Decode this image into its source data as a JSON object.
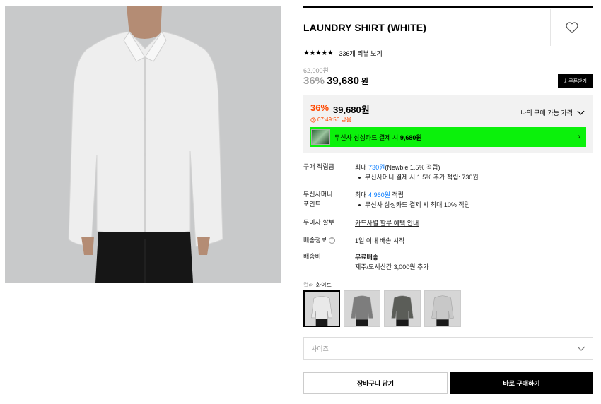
{
  "product": {
    "title": "LAUNDRY SHIRT (WHITE)",
    "rating_stars": "★★★★★",
    "review_link": "336개 리뷰 보기",
    "original_price": "62,000원",
    "discount_pct": "36%",
    "sale_price": "39,680",
    "sale_won": "원",
    "coupon_label": "쿠폰받기"
  },
  "benefit_box": {
    "discount_pct": "36%",
    "price": "39,680원",
    "timer": "07:49:56 남음",
    "my_price_label": "나의 구매 가능 가격",
    "card_banner_prefix": "무신사 삼성카드 결제 시 ",
    "card_banner_price": "9,680원"
  },
  "info": {
    "points_label": "구매 적립금",
    "points_prefix": "최대 ",
    "points_amount": "730원",
    "points_suffix": "(Newbie 1.5% 적립)",
    "points_bullet": "무신사머니 결제 시 1.5% 추가 적립: 730원",
    "money_label_1": "무신사머니",
    "money_label_2": "포인트",
    "money_prefix": "최대 ",
    "money_amount": "4,960원",
    "money_suffix": " 적립",
    "money_bullet": "무신사 삼성카드 결제 시 최대 10% 적립",
    "installment_label": "무이자 할부",
    "installment_link": "카드사별 할부 혜택 안내",
    "shipping_label": "배송정보",
    "shipping_value": "1일 이내 배송 시작",
    "fee_label": "배송비",
    "fee_value": "무료배송",
    "fee_extra": "제주/도서산간 3,000원 추가"
  },
  "options": {
    "color_label": "컬러",
    "color_value": "화이트",
    "swatch_colors": [
      "#e9e9e9",
      "#7d7d7d",
      "#5b5d58",
      "#c8c8c8"
    ],
    "size_placeholder": "사이즈"
  },
  "actions": {
    "cart_label": "장바구니 담기",
    "buy_label": "바로 구매하기"
  },
  "icons": {
    "heart": "heart-icon",
    "download": "download-icon",
    "clock": "clock-icon",
    "chevron": "chevron-down-icon"
  }
}
